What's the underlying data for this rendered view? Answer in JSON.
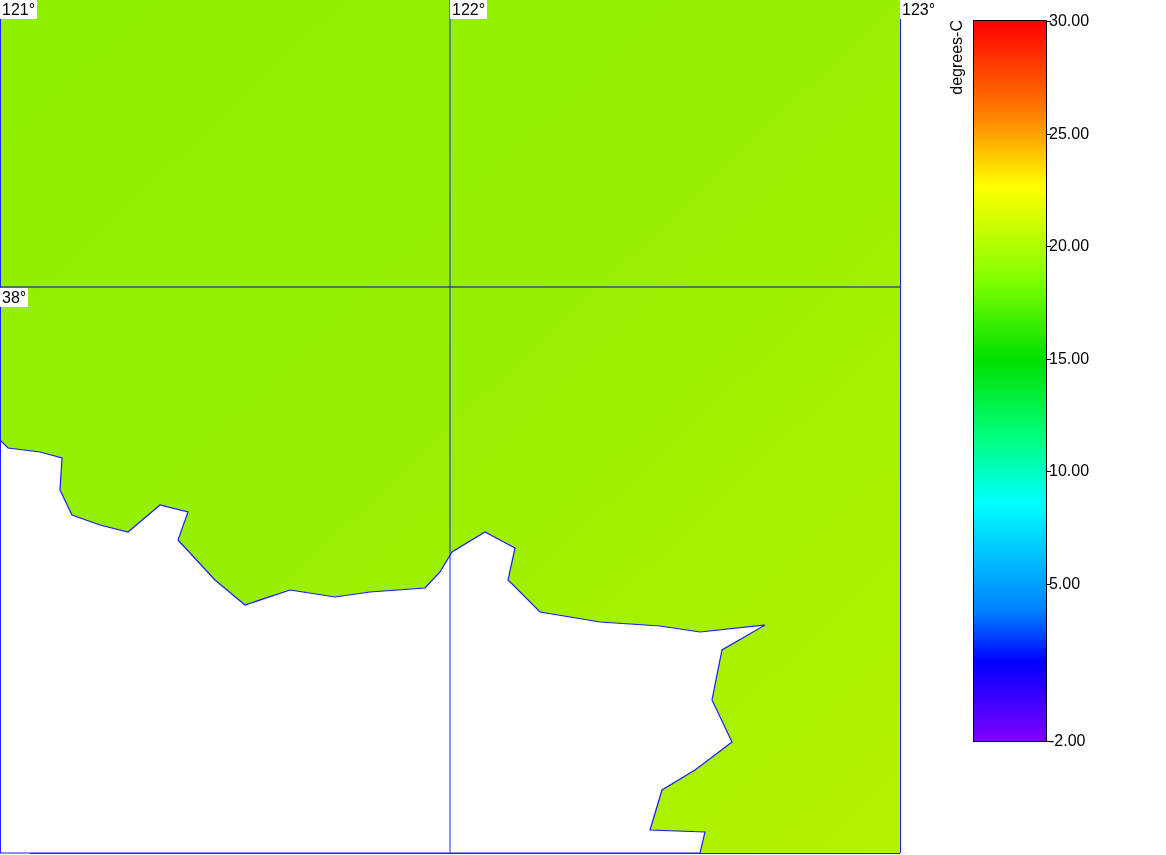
{
  "map": {
    "lon_labels": [
      "121°",
      "122°",
      "123°"
    ],
    "lat_labels": [
      "38°"
    ]
  },
  "colorbar": {
    "label": "degrees-C",
    "ticks": [
      "30.00",
      "25.00",
      "20.00",
      "15.00",
      "10.00",
      "5.00",
      "-2.00"
    ]
  }
}
